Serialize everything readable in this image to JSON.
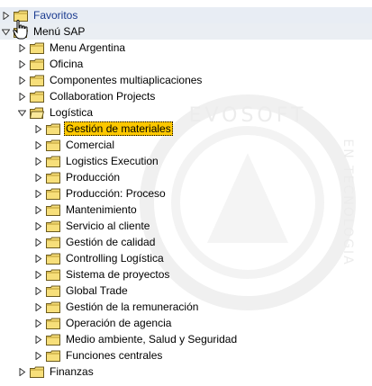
{
  "tree": {
    "watermark_text": "EVOSOFT",
    "watermark_side_text": "EN TECNOLOGIA",
    "root_items": [
      {
        "label": "Favoritos",
        "expanded": false
      },
      {
        "label": "Menú SAP",
        "expanded": true
      }
    ],
    "sap_children": [
      {
        "label": "Menu Argentina",
        "expanded": false
      },
      {
        "label": "Oficina",
        "expanded": false
      },
      {
        "label": "Componentes multiaplicaciones",
        "expanded": false
      },
      {
        "label": "Collaboration Projects",
        "expanded": false
      },
      {
        "label": "Logística",
        "expanded": true
      }
    ],
    "logistica_children": [
      {
        "label": "Gestión de materiales",
        "selected": true
      },
      {
        "label": "Comercial"
      },
      {
        "label": "Logistics Execution"
      },
      {
        "label": "Producción"
      },
      {
        "label": "Producción: Proceso"
      },
      {
        "label": "Mantenimiento"
      },
      {
        "label": "Servicio al cliente"
      },
      {
        "label": "Gestión de calidad"
      },
      {
        "label": "Controlling Logística"
      },
      {
        "label": "Sistema de proyectos"
      },
      {
        "label": "Global Trade"
      },
      {
        "label": "Gestión de la remuneración"
      },
      {
        "label": "Operación de agencia"
      },
      {
        "label": "Medio ambiente, Salud y Seguridad"
      },
      {
        "label": "Funciones centrales"
      }
    ],
    "after_items": [
      {
        "label": "Finanzas",
        "expanded": false
      }
    ]
  }
}
